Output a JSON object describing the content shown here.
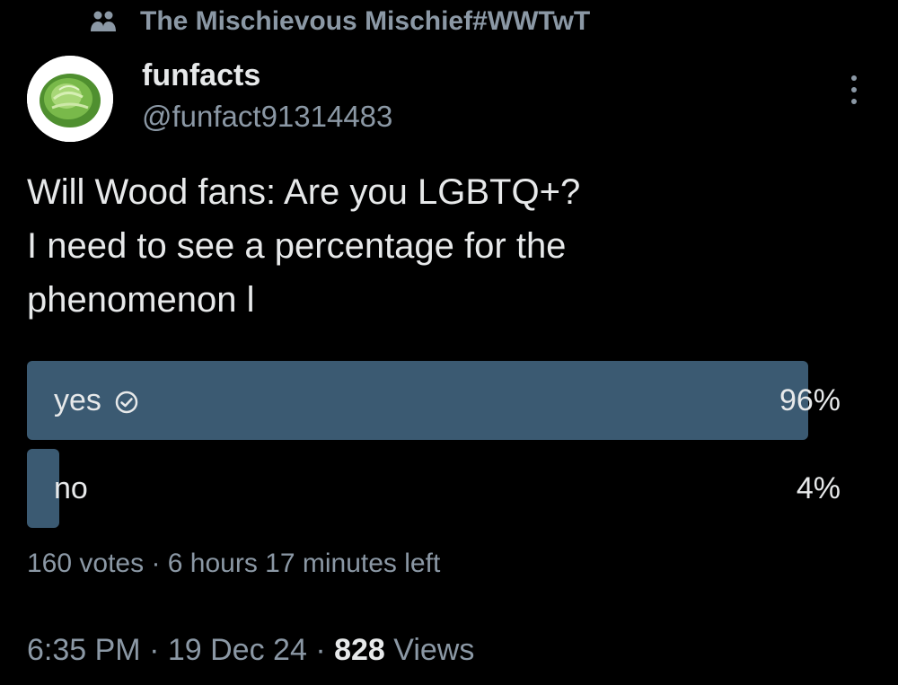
{
  "community": {
    "icon": "people-icon",
    "name": "The Mischievous Mischief#WWTwT"
  },
  "author": {
    "avatar_icon": "cabbage-avatar",
    "display_name": "funfacts",
    "handle": "@funfact91314483"
  },
  "more_icon": "more-vertical-icon",
  "tweet": {
    "lines": [
      "Will Wood fans: Are you LGBTQ+?",
      "I need to see a percentage for the",
      "phenomenon l"
    ]
  },
  "poll": {
    "options": [
      {
        "label": "yes",
        "percent_text": "96%",
        "share": 0.96,
        "selected": true,
        "icon": "check-circle-icon"
      },
      {
        "label": "no",
        "percent_text": "4%",
        "share": 0.04,
        "selected": false
      }
    ],
    "votes": "160 votes",
    "separator": "·",
    "time_left": "6 hours 17 minutes left"
  },
  "meta": {
    "time": "6:35 PM",
    "separator": "·",
    "date": "19 Dec 24",
    "views_count": "828",
    "views_label": "Views"
  },
  "colors": {
    "background": "#000000",
    "poll_fill": "#3b5a72",
    "primary_text": "#e7e9ea",
    "secondary_text": "#8b98a5"
  }
}
